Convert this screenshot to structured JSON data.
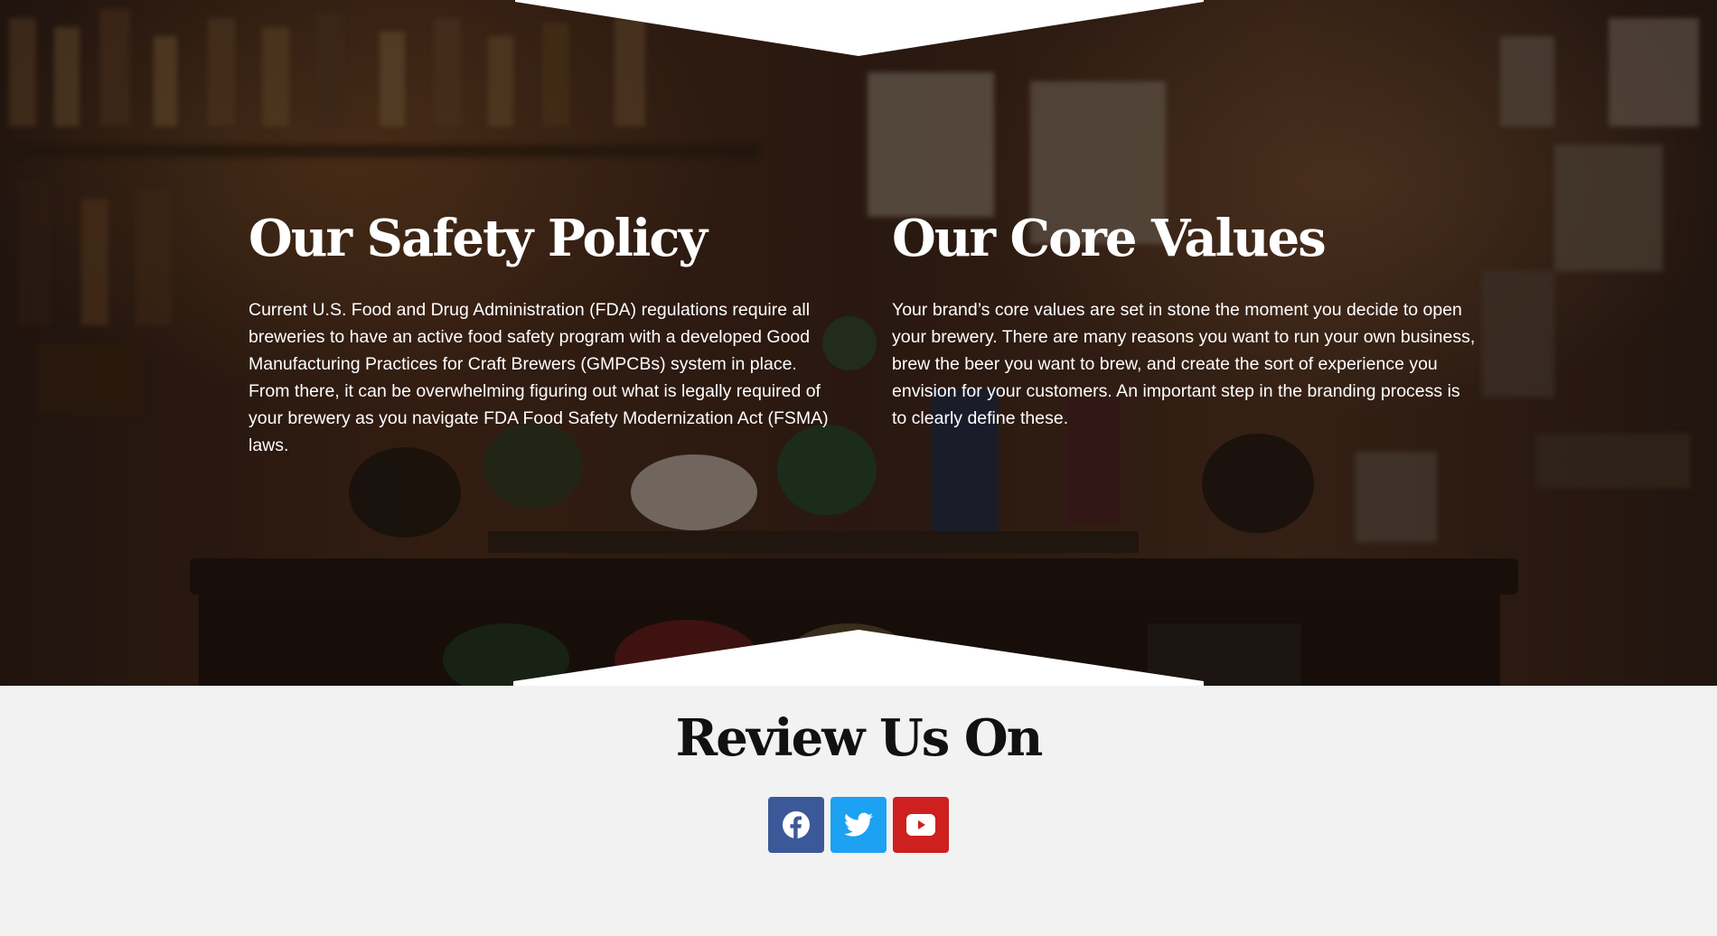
{
  "sections": {
    "safety": {
      "heading": "Our Safety Policy",
      "body": "Current U.S. Food and Drug Administration (FDA) regulations require all breweries to have an active food safety program with a developed Good Manufacturing Practices for Craft Brewers (GMPCBs) system in place. From there, it can be overwhelming figuring out what is legally required of your brewery as you navigate FDA Food Safety Modernization Act (FSMA) laws."
    },
    "values": {
      "heading": "Our Core Values",
      "body": "Your brand’s core values are set in stone the moment you decide to open your brewery. There are many reasons you want to run your own business, brew the beer you want to brew, and create the sort of experience you envision for your customers. An important step in the branding process is to clearly define these."
    }
  },
  "review": {
    "heading": "Review Us On",
    "socials": [
      {
        "icon": "facebook-icon",
        "color": "#3b5998"
      },
      {
        "icon": "twitter-icon",
        "color": "#1da1f2"
      },
      {
        "icon": "youtube-icon",
        "color": "#cd201f"
      }
    ]
  },
  "colors": {
    "background": "#f2f2f2",
    "heading_dark": "#111111",
    "overlay_text": "#ffffff"
  }
}
